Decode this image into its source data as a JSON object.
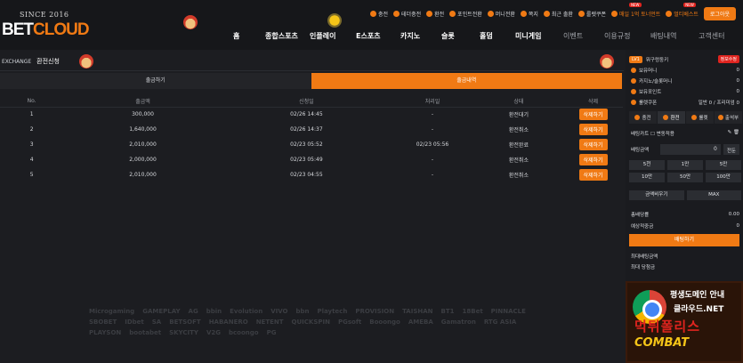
{
  "header": {
    "since": "SINCE 2016",
    "brand_bet": "BET",
    "brand_cloud": "CLOUD",
    "top_menu": [
      {
        "label": "충전",
        "icon": "deposit-icon"
      },
      {
        "label": "테더충전",
        "icon": "tether-icon"
      },
      {
        "label": "환전",
        "icon": "exchange-icon"
      },
      {
        "label": "포인트전환",
        "icon": "point-icon"
      },
      {
        "label": "머니전환",
        "icon": "money-icon"
      },
      {
        "label": "쪽지",
        "icon": "message-icon"
      },
      {
        "label": "최근 출환",
        "icon": "history-icon"
      },
      {
        "label": "룰렛쿠폰",
        "icon": "roulette-icon"
      },
      {
        "label": "매일 1억 토너먼트",
        "icon": "tournament-icon",
        "new": "NEW"
      },
      {
        "label": "멀티베스트",
        "icon": "multi-icon",
        "new": "NEW"
      }
    ],
    "login": "로그아웃",
    "nav": [
      "홈",
      "종합스포츠",
      "인플레이",
      "E스포츠",
      "카지노",
      "슬롯",
      "홀덤",
      "미니게임",
      "이벤트",
      "이용규정",
      "배팅내역",
      "고객센터"
    ]
  },
  "main": {
    "crumb_en": "EXCHANGE",
    "crumb_ko": "환전신청",
    "tabs": [
      "출금하기",
      "출금내역"
    ],
    "columns": [
      "No.",
      "출금액",
      "신청일",
      "처리일",
      "상태",
      "삭제"
    ],
    "rows": [
      {
        "no": "1",
        "amount": "300,000",
        "req": "02/26 14:45",
        "done": "-",
        "status": "환전대기",
        "del": "삭제하기"
      },
      {
        "no": "2",
        "amount": "1,640,000",
        "req": "02/26 14:37",
        "done": "-",
        "status": "환전취소",
        "del": "삭제하기"
      },
      {
        "no": "3",
        "amount": "2,010,000",
        "req": "02/23 05:52",
        "done": "02/23 05:56",
        "status": "환전완료",
        "del": "삭제하기"
      },
      {
        "no": "4",
        "amount": "2,000,000",
        "req": "02/23 05:49",
        "done": "-",
        "status": "환전취소",
        "del": "삭제하기"
      },
      {
        "no": "5",
        "amount": "2,010,000",
        "req": "02/23 04:55",
        "done": "-",
        "status": "환전취소",
        "del": "삭제하기"
      }
    ],
    "providers": [
      "Microgaming",
      "GAMEPLAY",
      "AG",
      "bbin",
      "Evolution",
      "VIVO",
      "bbn",
      "Playtech",
      "PROVISION",
      "TAISHAN",
      "BT1",
      "18Bet",
      "PINNACLE",
      "SBOBET",
      "IDbet",
      "SA",
      "BETSOFT",
      "HABANERO",
      "NETENT",
      "QUICKSPIN",
      "PGsoft",
      "Booongo",
      "AMEBA",
      "Gamatron",
      "RTG ASIA",
      "PLAYSON",
      "bootabet",
      "SKYCITY",
      "V2G",
      "bcoongo",
      "PG"
    ]
  },
  "sidebar": {
    "level": "LV1",
    "user": "뭐구렁둥키",
    "info_btn": "정보수정",
    "rows": [
      {
        "label": "보유머니",
        "value": "0"
      },
      {
        "label": "카지노/슬롯머니",
        "value": "0"
      },
      {
        "label": "보유포인트",
        "value": "0"
      },
      {
        "label": "룰렛쿠폰",
        "value": "일반 0 / 프리미엄 0"
      }
    ],
    "tabs": [
      "충전",
      "환전",
      "룰렛",
      "출석부"
    ],
    "cart": "배팅카트",
    "auto": "변동적용",
    "bet_amount_label": "배팅금액",
    "bet_amount": "0",
    "apply": "전둔",
    "amounts": [
      "5천",
      "1만",
      "5만",
      "10만",
      "50만",
      "100만"
    ],
    "reset": "금액비우기",
    "max": "MAX",
    "odds_label": "총배당률",
    "odds_value": "0.00",
    "expect_label": "예상적중금",
    "expect_value": "0",
    "bet_btn": "배팅하기",
    "max_bet": "최대배팅금액",
    "max_win": "최대 당첨금",
    "banner": {
      "line1": "평생도메인 안내",
      "line2": "클라우드.NET",
      "line3": "먹튀폴리스",
      "line4": "COMBAT"
    }
  }
}
